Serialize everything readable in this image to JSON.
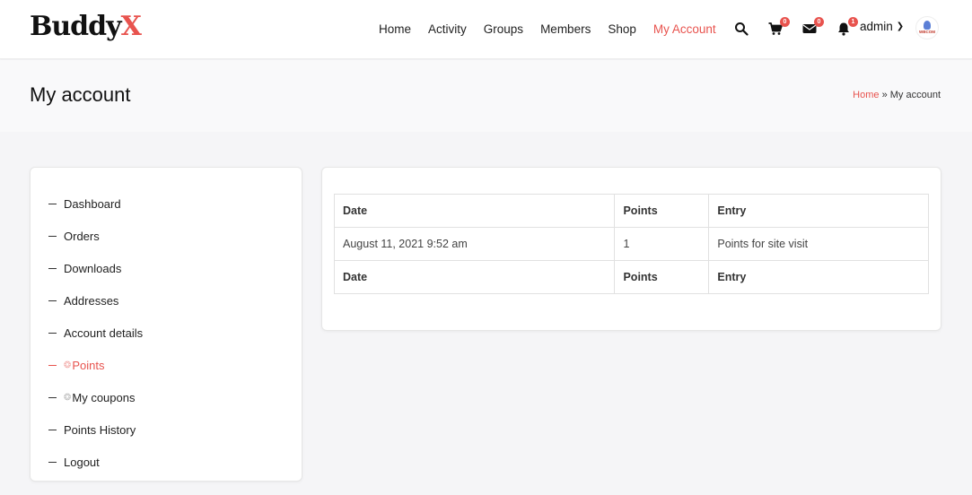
{
  "header": {
    "logo_main": "Buddy",
    "logo_accent": "X",
    "nav": [
      "Home",
      "Activity",
      "Groups",
      "Members",
      "Shop",
      "My Account"
    ],
    "active_nav": "My Account",
    "cart_count": "0",
    "messages_count": "0",
    "notifications_count": "1",
    "user_name": "admin",
    "avatar_text": "WBCOM"
  },
  "title_band": {
    "title": "My account",
    "breadcrumb_home": "Home",
    "breadcrumb_sep": "»",
    "breadcrumb_current": "My account"
  },
  "sidebar": {
    "items": [
      {
        "label": "Dashboard"
      },
      {
        "label": "Orders"
      },
      {
        "label": "Downloads"
      },
      {
        "label": "Addresses"
      },
      {
        "label": "Account details"
      },
      {
        "label": "Points",
        "icon": "points-icon",
        "active": true
      },
      {
        "label": "My coupons",
        "icon": "coupon-icon"
      },
      {
        "label": "Points History"
      },
      {
        "label": "Logout"
      }
    ]
  },
  "points_table": {
    "headers": [
      "Date",
      "Points",
      "Entry"
    ],
    "rows": [
      [
        "August 11, 2021 9:52 am",
        "1",
        "Points for site visit"
      ]
    ],
    "footers": [
      "Date",
      "Points",
      "Entry"
    ]
  },
  "colors": {
    "accent": "#e8534e",
    "page_bg": "#f5f5f7"
  }
}
